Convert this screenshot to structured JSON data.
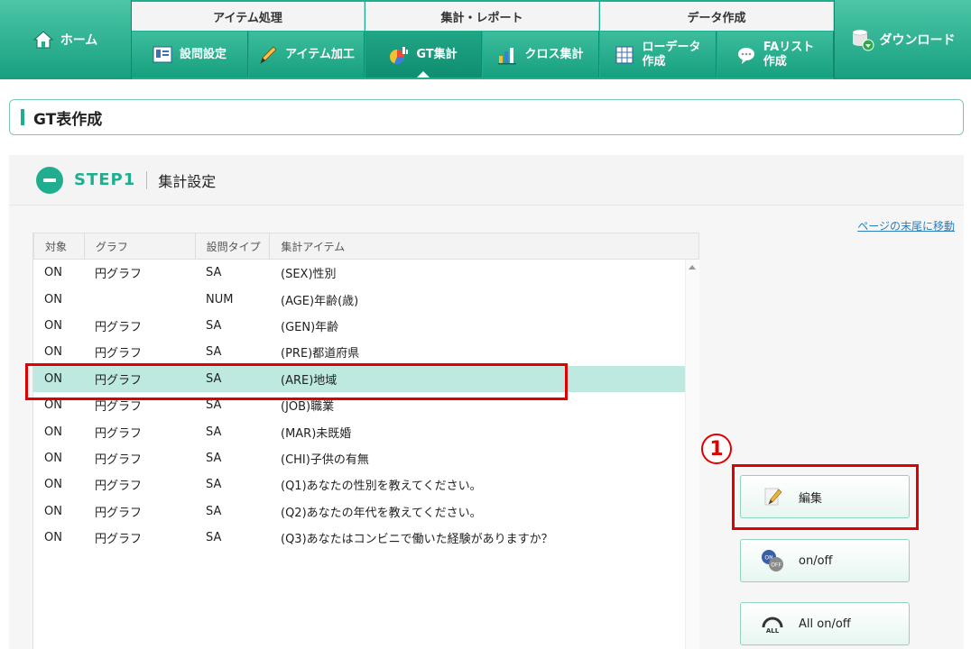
{
  "nav": {
    "home_label": "ホーム",
    "download_label": "ダウンロード",
    "groups": [
      {
        "label": "アイテム処理"
      },
      {
        "label": "集計・レポート"
      },
      {
        "label": "データ作成"
      }
    ],
    "tabs": [
      {
        "label": "設問設定"
      },
      {
        "label": "アイテム加工"
      },
      {
        "label": "GT集計",
        "active": true
      },
      {
        "label": "クロス集計"
      },
      {
        "label_line1": "ローデータ",
        "label_line2": "作成"
      },
      {
        "label_line1": "FAリスト",
        "label_line2": "作成"
      }
    ]
  },
  "page": {
    "title": "GT表作成"
  },
  "step": {
    "label": "STEP1",
    "title": "集計設定",
    "jump_link": "ページの末尾に移動"
  },
  "table": {
    "headers": [
      "対象",
      "グラフ",
      "設問タイプ",
      "集計アイテム"
    ],
    "rows": [
      {
        "target": "ON",
        "graph": "円グラフ",
        "type": "SA",
        "item": "(SEX)性別"
      },
      {
        "target": "ON",
        "graph": "",
        "type": "NUM",
        "item": "(AGE)年齢(歳)"
      },
      {
        "target": "ON",
        "graph": "円グラフ",
        "type": "SA",
        "item": "(GEN)年齢"
      },
      {
        "target": "ON",
        "graph": "円グラフ",
        "type": "SA",
        "item": "(PRE)都道府県"
      },
      {
        "target": "ON",
        "graph": "円グラフ",
        "type": "SA",
        "item": "(ARE)地域",
        "selected": true
      },
      {
        "target": "ON",
        "graph": "円グラフ",
        "type": "SA",
        "item": "(JOB)職業"
      },
      {
        "target": "ON",
        "graph": "円グラフ",
        "type": "SA",
        "item": "(MAR)未既婚"
      },
      {
        "target": "ON",
        "graph": "円グラフ",
        "type": "SA",
        "item": "(CHI)子供の有無"
      },
      {
        "target": "ON",
        "graph": "円グラフ",
        "type": "SA",
        "item": "(Q1)あなたの性別を教えてください。"
      },
      {
        "target": "ON",
        "graph": "円グラフ",
        "type": "SA",
        "item": "(Q2)あなたの年代を教えてください。"
      },
      {
        "target": "ON",
        "graph": "円グラフ",
        "type": "SA",
        "item": "(Q3)あなたはコンビニで働いた経験がありますか？"
      }
    ]
  },
  "actions": {
    "marker": "1",
    "edit_label": "編集",
    "onoff_label": "on/off",
    "all_onoff_label": "All on/off"
  },
  "colors": {
    "brand": "#1fae8f",
    "selected_row": "#bde9e0",
    "highlight": "#e00000"
  }
}
